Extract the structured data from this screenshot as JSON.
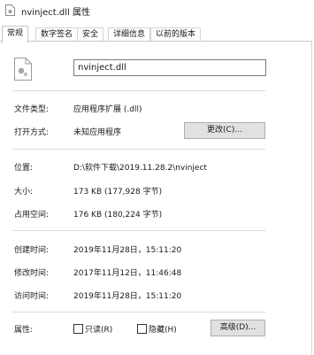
{
  "window": {
    "title": "nvinject.dll 属性"
  },
  "tabs": [
    {
      "label": "常规"
    },
    {
      "label": "数字签名"
    },
    {
      "label": "安全"
    },
    {
      "label": "详细信息"
    },
    {
      "label": "以前的版本"
    }
  ],
  "general": {
    "file_name": "nvinject.dll",
    "file_type_label": "文件类型:",
    "file_type_value": "应用程序扩展 (.dll)",
    "open_with_label": "打开方式:",
    "open_with_value": "未知应用程序",
    "change_button": "更改(C)...",
    "location_label": "位置:",
    "location_value": "D:\\软件下载\\2019.11.28.2\\nvinject",
    "size_label": "大小:",
    "size_value": "173 KB (177,928 字节)",
    "size_on_disk_label": "占用空间:",
    "size_on_disk_value": "176 KB (180,224 字节)",
    "created_label": "创建时间:",
    "created_value": "2019年11月28日，15:11:20",
    "modified_label": "修改时间:",
    "modified_value": "2017年11月12日，11:46:48",
    "accessed_label": "访问时间:",
    "accessed_value": "2019年11月28日，15:11:20",
    "attributes_label": "属性:",
    "readonly_label": "只读(R)",
    "hidden_label": "隐藏(H)",
    "advanced_button": "高级(D)..."
  },
  "icons": {
    "title": "dll-file-icon",
    "file": "dll-file-icon"
  }
}
